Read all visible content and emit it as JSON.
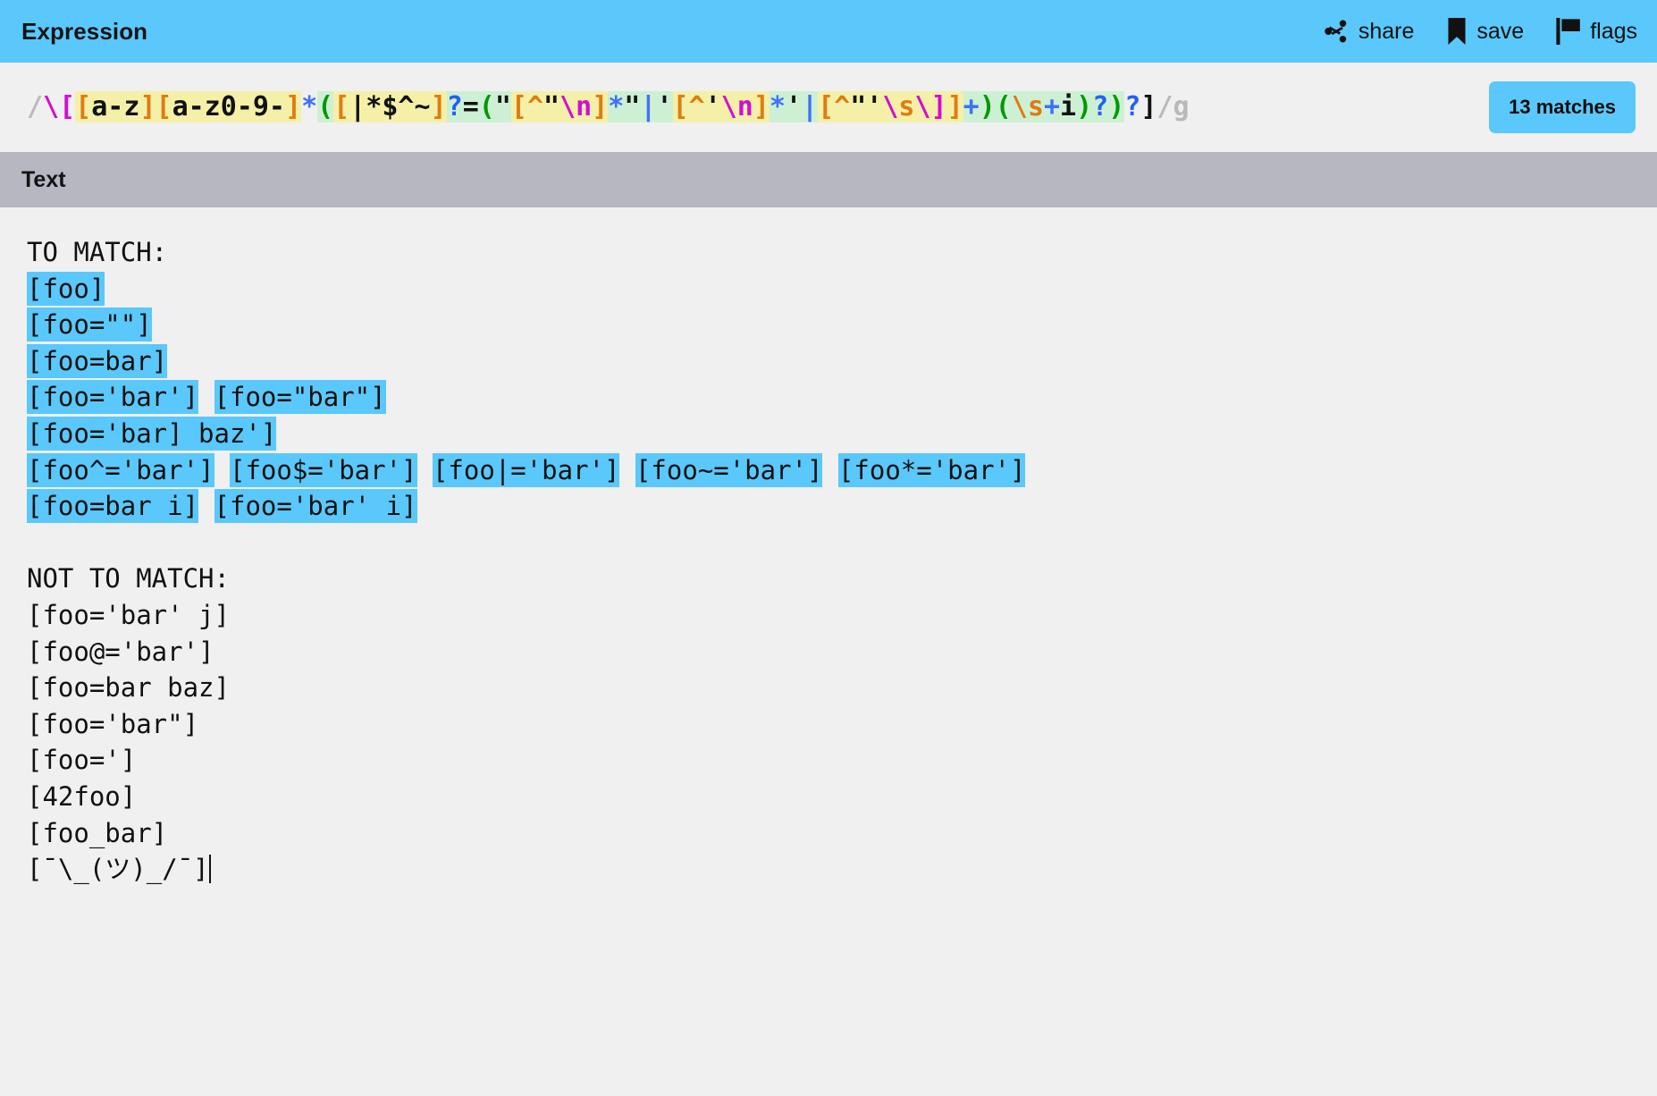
{
  "header": {
    "title": "Expression",
    "actions": [
      {
        "icon": "share-icon",
        "label": "share"
      },
      {
        "icon": "bookmark-save-icon",
        "label": "save"
      },
      {
        "icon": "flag-icon",
        "label": "flags"
      }
    ],
    "background_color": "#5ac8fa"
  },
  "expression": {
    "full_pattern": "/\\[[a-z][a-z0-9-]*([|*$^~]?=(\"[^\"\\n]*\"|'[^'\\n]*'|[^\"'\\s\\]]+)(\\s+i)?)?]/g",
    "delimiter_open": "/",
    "delimiter_close": "/",
    "flags": "g",
    "match_count_label": "13 matches",
    "match_count": 13,
    "tokens": [
      {
        "t": "/",
        "cls": "c-delim",
        "hl": ""
      },
      {
        "t": "\\",
        "cls": "c-meta",
        "hl": ""
      },
      {
        "t": "[",
        "cls": "c-meta",
        "hl": ""
      },
      {
        "t": "[",
        "cls": "c-bracket",
        "hl": "hl-y"
      },
      {
        "t": "a-z",
        "cls": "c-lit",
        "hl": "hl-y"
      },
      {
        "t": "]",
        "cls": "c-bracket",
        "hl": "hl-y"
      },
      {
        "t": "[",
        "cls": "c-bracket",
        "hl": "hl-y"
      },
      {
        "t": "a-z0-9-",
        "cls": "c-lit",
        "hl": "hl-y"
      },
      {
        "t": "]",
        "cls": "c-bracket",
        "hl": "hl-y"
      },
      {
        "t": "*",
        "cls": "c-quant",
        "hl": ""
      },
      {
        "t": "(",
        "cls": "c-group",
        "hl": "hl-g"
      },
      {
        "t": "[",
        "cls": "c-bracket",
        "hl": "hl-y"
      },
      {
        "t": "|*$^~",
        "cls": "c-lit",
        "hl": "hl-y"
      },
      {
        "t": "]",
        "cls": "c-bracket",
        "hl": "hl-y"
      },
      {
        "t": "?",
        "cls": "c-opt",
        "hl": "hl-g"
      },
      {
        "t": "=",
        "cls": "c-lit",
        "hl": "hl-g"
      },
      {
        "t": "(",
        "cls": "c-group",
        "hl": "hl-g"
      },
      {
        "t": "\"",
        "cls": "c-lit",
        "hl": "hl-g"
      },
      {
        "t": "[",
        "cls": "c-bracket",
        "hl": "hl-y"
      },
      {
        "t": "^",
        "cls": "c-bracket",
        "hl": "hl-y"
      },
      {
        "t": "\"",
        "cls": "c-lit",
        "hl": "hl-y"
      },
      {
        "t": "\\n",
        "cls": "c-meta",
        "hl": "hl-y"
      },
      {
        "t": "]",
        "cls": "c-bracket",
        "hl": "hl-y"
      },
      {
        "t": "*",
        "cls": "c-quant",
        "hl": "hl-g"
      },
      {
        "t": "\"",
        "cls": "c-lit",
        "hl": "hl-g"
      },
      {
        "t": "|",
        "cls": "c-quant",
        "hl": "hl-g"
      },
      {
        "t": "'",
        "cls": "c-lit",
        "hl": "hl-g"
      },
      {
        "t": "[",
        "cls": "c-bracket",
        "hl": "hl-y"
      },
      {
        "t": "^",
        "cls": "c-bracket",
        "hl": "hl-y"
      },
      {
        "t": "'",
        "cls": "c-lit",
        "hl": "hl-y"
      },
      {
        "t": "\\n",
        "cls": "c-meta",
        "hl": "hl-y"
      },
      {
        "t": "]",
        "cls": "c-bracket",
        "hl": "hl-y"
      },
      {
        "t": "*",
        "cls": "c-quant",
        "hl": "hl-g"
      },
      {
        "t": "'",
        "cls": "c-lit",
        "hl": "hl-g"
      },
      {
        "t": "|",
        "cls": "c-quant",
        "hl": "hl-g"
      },
      {
        "t": "[",
        "cls": "c-bracket",
        "hl": "hl-y"
      },
      {
        "t": "^",
        "cls": "c-bracket",
        "hl": "hl-y"
      },
      {
        "t": "\"'",
        "cls": "c-lit",
        "hl": "hl-y"
      },
      {
        "t": "\\",
        "cls": "c-meta",
        "hl": "hl-y"
      },
      {
        "t": "s",
        "cls": "c-bracket",
        "hl": "hl-y"
      },
      {
        "t": "\\]",
        "cls": "c-meta",
        "hl": "hl-y"
      },
      {
        "t": "]",
        "cls": "c-bracket",
        "hl": "hl-y"
      },
      {
        "t": "+",
        "cls": "c-quant",
        "hl": "hl-g"
      },
      {
        "t": ")",
        "cls": "c-group",
        "hl": "hl-g"
      },
      {
        "t": "(",
        "cls": "c-group",
        "hl": "hl-g"
      },
      {
        "t": "\\",
        "cls": "c-bracket",
        "hl": "hl-g"
      },
      {
        "t": "s",
        "cls": "c-bracket",
        "hl": "hl-g"
      },
      {
        "t": "+",
        "cls": "c-quant",
        "hl": "hl-g"
      },
      {
        "t": "i",
        "cls": "c-lit",
        "hl": "hl-g"
      },
      {
        "t": ")",
        "cls": "c-group",
        "hl": "hl-g"
      },
      {
        "t": "?",
        "cls": "c-opt",
        "hl": "hl-g"
      },
      {
        "t": ")",
        "cls": "c-group",
        "hl": "hl-g"
      },
      {
        "t": "?",
        "cls": "c-opt",
        "hl": ""
      },
      {
        "t": "]",
        "cls": "c-lit",
        "hl": ""
      },
      {
        "t": "/",
        "cls": "c-delim",
        "hl": ""
      },
      {
        "t": "g",
        "cls": "c-delim",
        "hl": ""
      }
    ]
  },
  "text_panel": {
    "title": "Text",
    "lines": [
      {
        "segments": [
          {
            "text": "TO MATCH:",
            "match": false
          }
        ]
      },
      {
        "segments": [
          {
            "text": "[foo]",
            "match": true
          }
        ]
      },
      {
        "segments": [
          {
            "text": "[foo=\"\"]",
            "match": true
          }
        ]
      },
      {
        "segments": [
          {
            "text": "[foo=bar]",
            "match": true
          }
        ]
      },
      {
        "segments": [
          {
            "text": "[foo='bar']",
            "match": true
          },
          {
            "text": " ",
            "match": false
          },
          {
            "text": "[foo=\"bar\"]",
            "match": true
          }
        ]
      },
      {
        "segments": [
          {
            "text": "[foo='bar] baz']",
            "match": true
          }
        ]
      },
      {
        "segments": [
          {
            "text": "[foo^='bar']",
            "match": true
          },
          {
            "text": " ",
            "match": false
          },
          {
            "text": "[foo$='bar']",
            "match": true
          },
          {
            "text": " ",
            "match": false
          },
          {
            "text": "[foo|='bar']",
            "match": true
          },
          {
            "text": " ",
            "match": false
          },
          {
            "text": "[foo~='bar']",
            "match": true
          },
          {
            "text": " ",
            "match": false
          },
          {
            "text": "[foo*='bar']",
            "match": true
          }
        ]
      },
      {
        "segments": [
          {
            "text": "[foo=bar i]",
            "match": true
          },
          {
            "text": " ",
            "match": false
          },
          {
            "text": "[foo='bar' i]",
            "match": true
          }
        ]
      },
      {
        "segments": [
          {
            "text": "",
            "match": false
          }
        ]
      },
      {
        "segments": [
          {
            "text": "NOT TO MATCH:",
            "match": false
          }
        ]
      },
      {
        "segments": [
          {
            "text": "[foo='bar' j]",
            "match": false
          }
        ]
      },
      {
        "segments": [
          {
            "text": "[foo@='bar']",
            "match": false
          }
        ]
      },
      {
        "segments": [
          {
            "text": "[foo=bar baz]",
            "match": false
          }
        ]
      },
      {
        "segments": [
          {
            "text": "[foo='bar\"]",
            "match": false
          }
        ]
      },
      {
        "segments": [
          {
            "text": "[foo=']",
            "match": false
          }
        ]
      },
      {
        "segments": [
          {
            "text": "[42foo]",
            "match": false
          }
        ]
      },
      {
        "segments": [
          {
            "text": "[foo_bar]",
            "match": false
          }
        ]
      },
      {
        "segments": [
          {
            "text": "[¯\\_(ツ)_/¯]",
            "match": false,
            "caret": true
          }
        ]
      }
    ]
  },
  "colors": {
    "accent": "#5ac8fa",
    "text_header_bg": "#b7b7c2",
    "page_bg": "#f0f0f0",
    "match_highlight": "#5ac8fa",
    "regex_group_highlight": "#cdf0d4",
    "regex_class_highlight": "#f4f0a8"
  }
}
